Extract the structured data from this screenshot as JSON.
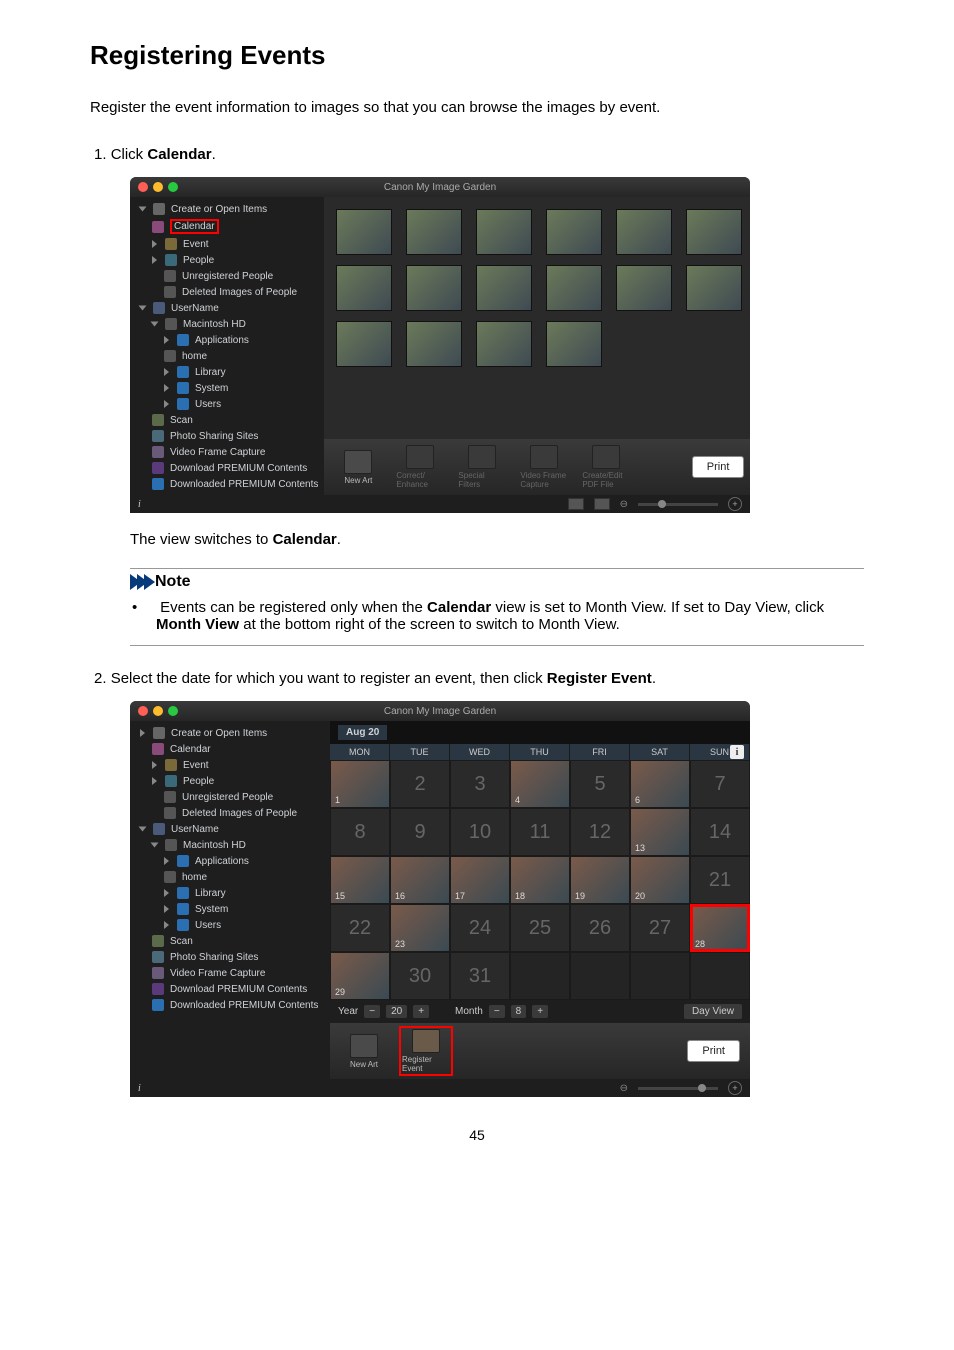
{
  "title": "Registering Events",
  "intro": "Register the event information to images so that you can browse the images by event.",
  "step1_prefix": "1.  ",
  "step1_text_a": "Click ",
  "step1_text_b": "Calendar",
  "step1_text_c": ".",
  "view_switch_a": "The view switches to ",
  "view_switch_b": "Calendar",
  "view_switch_c": ".",
  "note_label": "Note",
  "note_body_a": "Events can be registered only when the ",
  "note_body_b": "Calendar",
  "note_body_c": " view is set to Month View. If set to Day View, click ",
  "note_body_d": "Month View",
  "note_body_e": " at the bottom right of the screen to switch to Month View.",
  "step2_prefix": "2.  ",
  "step2_text_a": "Select the date for which you want to register an event, then click ",
  "step2_text_b": "Register Event",
  "step2_text_c": ".",
  "page_number": "45",
  "shot": {
    "window_title": "Canon My Image Garden",
    "sidebar": {
      "create": "Create or Open Items",
      "calendar": "Calendar",
      "event": "Event",
      "people": "People",
      "unreg": "Unregistered People",
      "delpeople": "Deleted Images of People",
      "username": "UserName",
      "machd": "Macintosh HD",
      "apps": "Applications",
      "home": "home",
      "library": "Library",
      "system": "System",
      "users": "Users",
      "scan": "Scan",
      "photoshare": "Photo Sharing Sites",
      "vfc": "Video Frame Capture",
      "dlprem": "Download PREMIUM Contents",
      "dldprem": "Downloaded PREMIUM Contents"
    },
    "toolbar": {
      "newart": "New Art",
      "correct": "Correct/\nEnhance",
      "filters": "Special\nFilters",
      "vfc": "Video Frame\nCapture",
      "pdf": "Create/Edit\nPDF File",
      "print": "Print",
      "regevent": "Register\nEvent"
    },
    "status_i": "i"
  },
  "cal": {
    "month_label": "Aug 20",
    "weekdays": [
      "MON",
      "TUE",
      "WED",
      "THU",
      "FRI",
      "SAT",
      "SUN"
    ],
    "year_label": "Year",
    "year_val": "20",
    "month_nav_label": "Month",
    "month_val": "8",
    "dayview": "Day View"
  }
}
